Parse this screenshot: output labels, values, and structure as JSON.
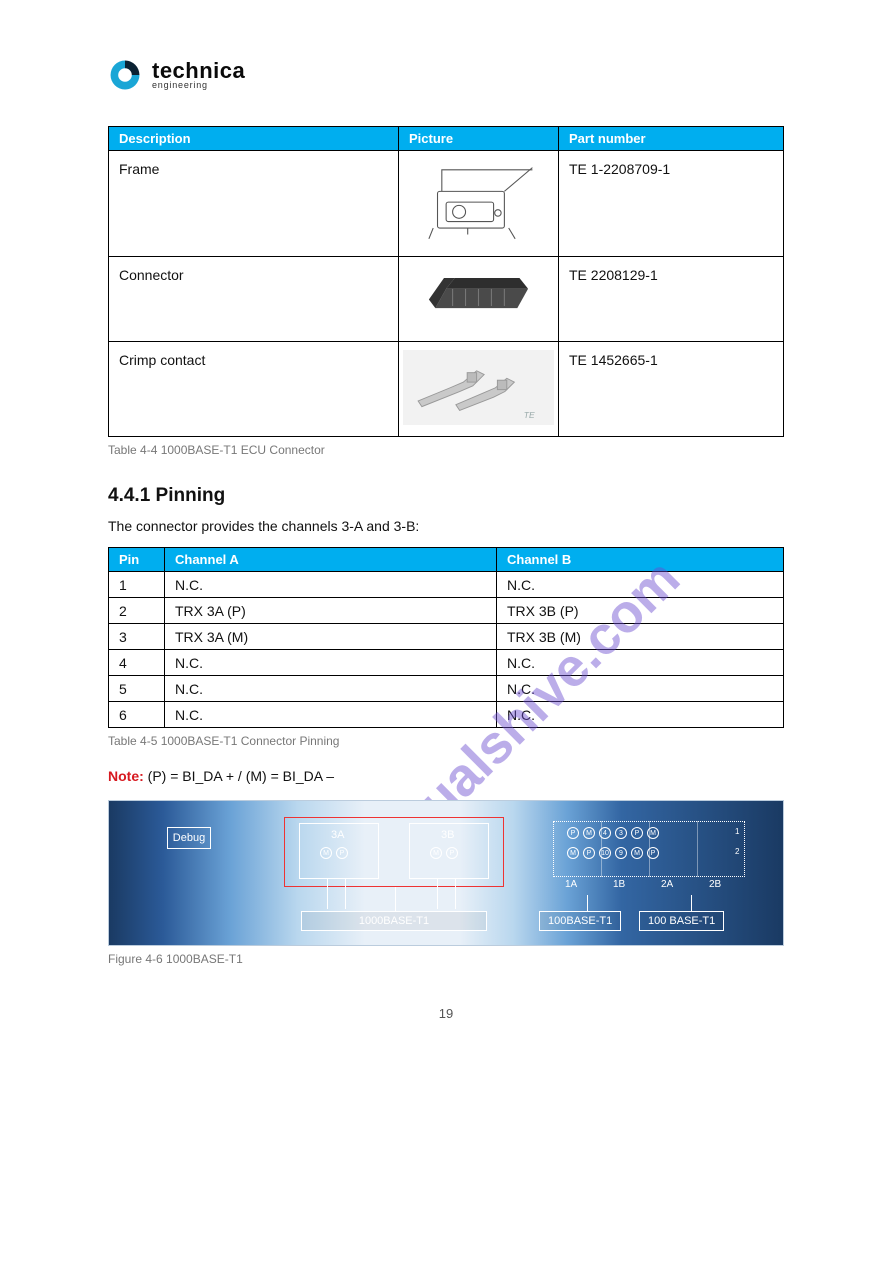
{
  "brand": {
    "name": "technica",
    "tagline": "engineering"
  },
  "table4": {
    "headers": [
      "Description",
      "Picture",
      "Part number"
    ],
    "rows": [
      {
        "desc": "Frame",
        "part": "TE 1-2208709-1"
      },
      {
        "desc": "Connector",
        "part": "TE 2208129-1"
      },
      {
        "desc": "Crimp contact",
        "part": "TE 1452665-1"
      }
    ],
    "caption": "Table 4-4 1000BASE-T1 ECU Connector"
  },
  "section": {
    "num": "4.4.1",
    "title": "Pinning",
    "intro": "The connector provides the channels 3-A and 3-B:"
  },
  "table5": {
    "headers": [
      "Pin",
      "Channel A",
      "Channel B"
    ],
    "rows": [
      {
        "pin": "1",
        "a": "N.C.",
        "b": "N.C."
      },
      {
        "pin": "2",
        "a": "TRX 3A (P)",
        "b": "TRX 3B (P)"
      },
      {
        "pin": "3",
        "a": "TRX 3A (M)",
        "b": "TRX 3B (M)"
      },
      {
        "pin": "4",
        "a": "N.C.",
        "b": "N.C."
      },
      {
        "pin": "5",
        "a": "N.C.",
        "b": "N.C."
      },
      {
        "pin": "6",
        "a": "N.C.",
        "b": "N.C."
      }
    ],
    "caption": "Table 4-5 1000BASE-T1 Connector Pinning"
  },
  "note": {
    "label": "Note:",
    "text": "(P) = BI_DA +  /  (M) = BI_DA –"
  },
  "switch": {
    "debug": "Debug",
    "ports3": {
      "a": "3A",
      "b": "3B"
    },
    "mp": {
      "m": "M",
      "p": "P"
    },
    "pinrow1": [
      "P",
      "M",
      "4",
      "3",
      "P",
      "M"
    ],
    "pinrow2": [
      "M",
      "P",
      "10",
      "9",
      "M",
      "P"
    ],
    "rownum1": "1",
    "rownum2": "2",
    "bays": [
      "1A",
      "1B",
      "2A",
      "2B"
    ],
    "badges": {
      "k": "1000BASE-T1",
      "h1": "100BASE-T1",
      "h2": "100 BASE-T1"
    }
  },
  "figure_caption": "Figure 4-6 1000BASE-T1",
  "footer_page": "19"
}
